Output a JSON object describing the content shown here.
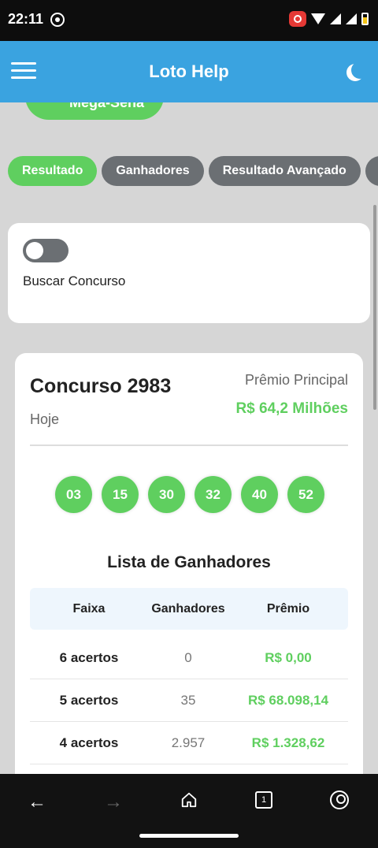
{
  "status_bar": {
    "time": "22:11"
  },
  "app_bar": {
    "title": "Loto Help"
  },
  "game_button": {
    "label": "Mega-Sena"
  },
  "tabs": [
    {
      "label": "Resultado",
      "active": true
    },
    {
      "label": "Ganhadores",
      "active": false
    },
    {
      "label": "Resultado Avançado",
      "active": false
    }
  ],
  "search": {
    "label": "Buscar Concurso",
    "toggle_on": false
  },
  "result": {
    "title": "Concurso 2983",
    "date": "Hoje",
    "prize_label": "Prêmio Principal",
    "prize_value": "R$ 64,2 Milhões",
    "numbers": [
      "03",
      "15",
      "30",
      "32",
      "40",
      "52"
    ]
  },
  "winners": {
    "title": "Lista de Ganhadores",
    "headers": [
      "Faixa",
      "Ganhadores",
      "Prêmio"
    ],
    "rows": [
      {
        "faixa": "6 acertos",
        "ganhadores": "0",
        "premio": "R$ 0,00"
      },
      {
        "faixa": "5 acertos",
        "ganhadores": "35",
        "premio": "R$ 68.098,14"
      },
      {
        "faixa": "4 acertos",
        "ganhadores": "2.957",
        "premio": "R$ 1.328,62"
      }
    ]
  },
  "bottom_nav": {
    "tab_count": "1"
  },
  "colors": {
    "accent_green": "#5fcf5f",
    "app_bar_blue": "#3aa3e0",
    "inactive_gray": "#6b6f73"
  }
}
